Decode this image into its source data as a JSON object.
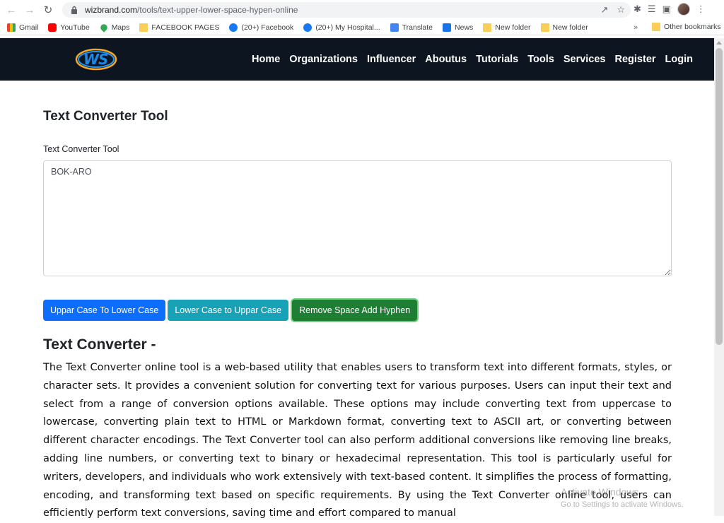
{
  "browser": {
    "url_domain": "wizbrand.com",
    "url_path": "/tools/text-upper-lower-space-hypen-online"
  },
  "bookmarks": [
    {
      "label": "Gmail",
      "icon": "gmail-icon"
    },
    {
      "label": "YouTube",
      "icon": "youtube-icon"
    },
    {
      "label": "Maps",
      "icon": "maps-icon"
    },
    {
      "label": "FACEBOOK PAGES",
      "icon": "folder-icon"
    },
    {
      "label": "(20+) Facebook",
      "icon": "facebook-icon"
    },
    {
      "label": "(20+) My Hospital...",
      "icon": "facebook-icon"
    },
    {
      "label": "Translate",
      "icon": "translate-icon"
    },
    {
      "label": "News",
      "icon": "news-icon"
    },
    {
      "label": "New folder",
      "icon": "folder-icon"
    },
    {
      "label": "New folder",
      "icon": "folder-icon"
    }
  ],
  "bookmarks_more": "»",
  "bookmarks_other": "Other bookmarks",
  "site": {
    "logo_text": "WS",
    "nav": [
      "Home",
      "Organizations",
      "Influencer",
      "Aboutus",
      "Tutorials",
      "Tools",
      "Services",
      "Register",
      "Login"
    ]
  },
  "tool": {
    "title": "Text Converter Tool",
    "field_label": "Text Converter Tool",
    "input_value": "BOK-ARO",
    "buttons": {
      "upper_to_lower": "Uppar Case To Lower Case",
      "lower_to_upper": "Lower Case to Uppar Case",
      "remove_space": "Remove Space Add Hyphen"
    }
  },
  "article": {
    "heading": "Text Converter -",
    "body": "The Text Converter online tool is a web-based utility that enables users to transform text into different formats, styles, or character sets. It provides a convenient solution for converting text for various purposes. Users can input their text and select from a range of conversion options available. These options may include converting text from uppercase to lowercase, converting plain text to HTML or Markdown format, converting text to ASCII art, or converting between different character encodings. The Text Converter tool can also perform additional conversions like removing line breaks, adding line numbers, or converting text to binary or hexadecimal representation. This tool is particularly useful for writers, developers, and individuals who work extensively with text-based content. It simplifies the process of formatting, encoding, and transforming text based on specific requirements. By using the Text Converter online tool, users can efficiently perform text conversions, saving time and effort compared to manual"
  },
  "watermark": {
    "line1": "Activate Windows",
    "line2": "Go to Settings to activate Windows."
  },
  "colors": {
    "nav_bg": "#0d1520",
    "btn_primary": "#0d6efd",
    "btn_info": "#17a2b8",
    "btn_success": "#1e7e34"
  }
}
